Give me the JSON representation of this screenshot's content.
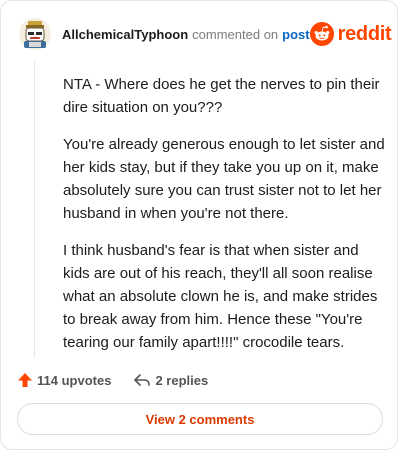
{
  "header": {
    "author": "AllchemicalTyphoon",
    "commented_text": "commented on",
    "post_link": "post",
    "brand_name": "reddit"
  },
  "comment": {
    "paragraphs": [
      "NTA - Where does he get the nerves to pin their dire situation on you???",
      "You're already generous enough to let sister and her kids stay, but if they take you up on it, make absolutely sure you can trust sister not to let her husband in when you're not there.",
      "I think husband's fear is that when sister and kids are out of his reach, they'll all soon realise what an absolute clown he is, and make strides to break away from him. Hence these \"You're tearing our family apart!!!!\" crocodile tears."
    ]
  },
  "actions": {
    "upvotes": "114 upvotes",
    "replies": "2 replies"
  },
  "footer": {
    "view_comments": "View 2 comments"
  },
  "icons": {
    "avatar": "snoo-avatar-icon",
    "brand": "reddit-logo-icon",
    "upvote": "upvote-arrow-icon",
    "reply": "reply-arrow-icon"
  },
  "colors": {
    "brand": "#ff4500",
    "upvote": "#ff4500",
    "link": "#0a66c2",
    "view_comments": "#d93a00"
  }
}
